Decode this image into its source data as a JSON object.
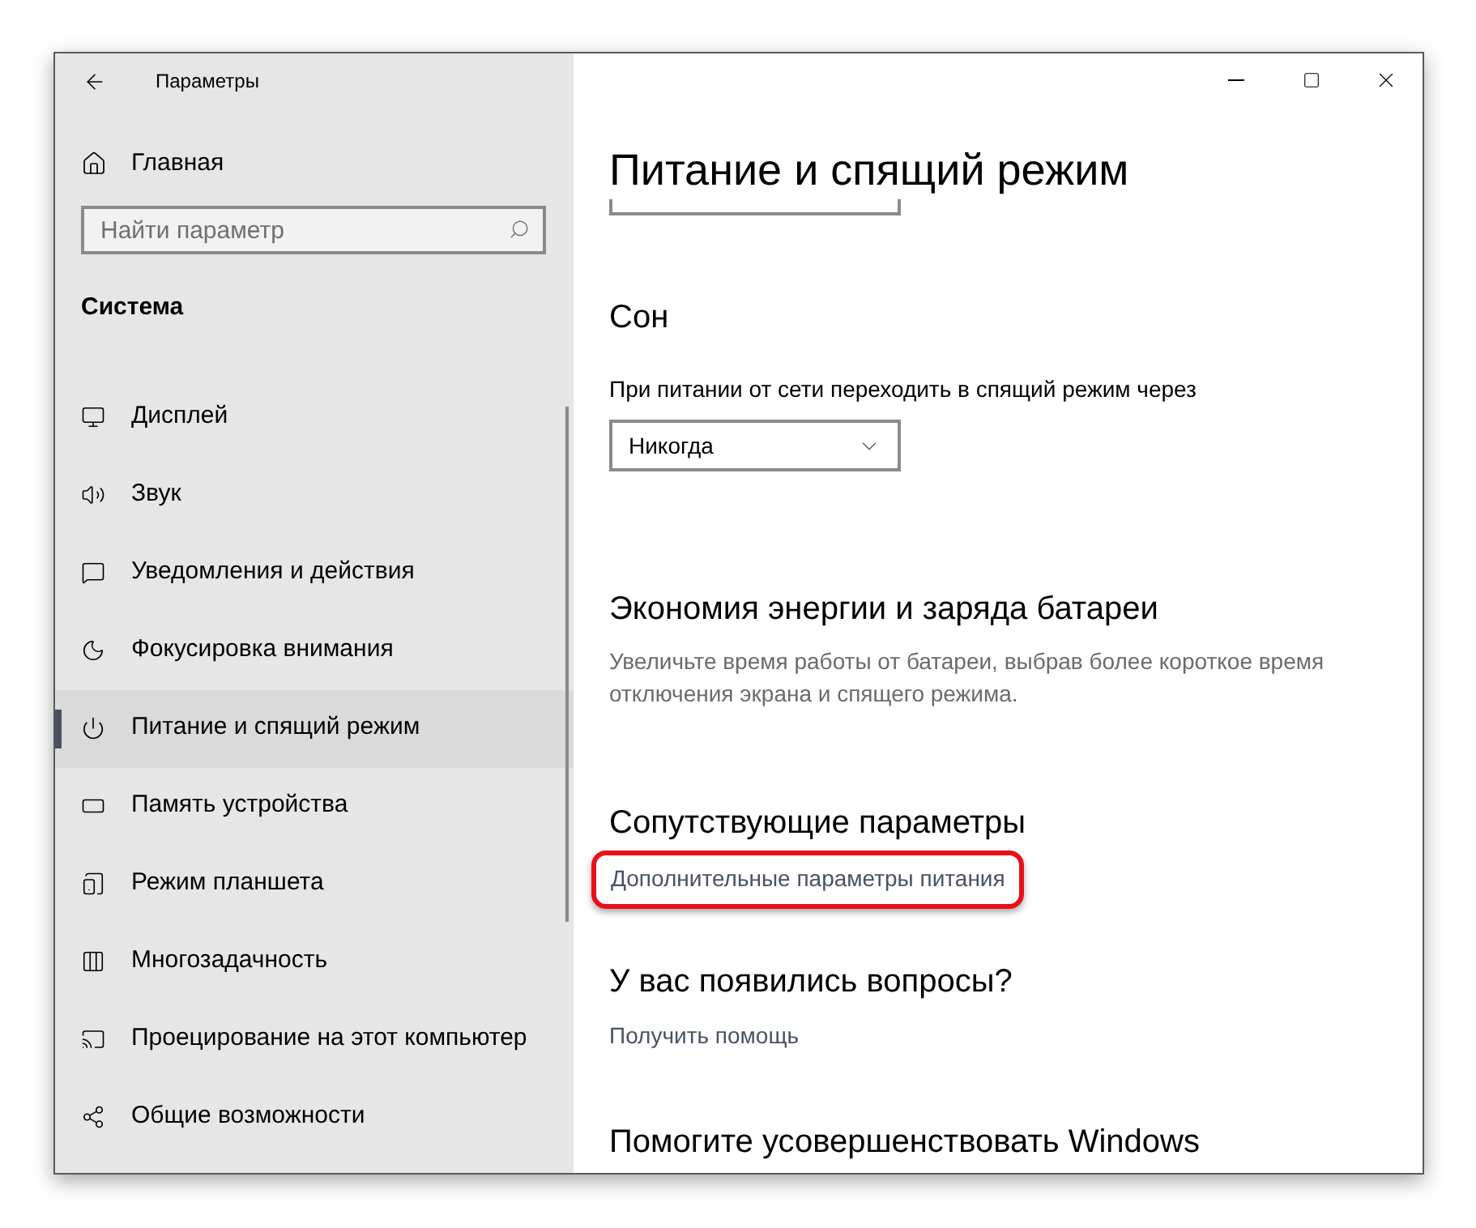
{
  "window": {
    "title": "Параметры"
  },
  "sidebar": {
    "home": "Главная",
    "search": {
      "placeholder": "Найти параметр"
    },
    "section": "Система",
    "items": [
      {
        "label": "Дисплей",
        "kind": "display",
        "selected": false
      },
      {
        "label": "Звук",
        "kind": "sound",
        "selected": false
      },
      {
        "label": "Уведомления и действия",
        "kind": "notifications",
        "selected": false
      },
      {
        "label": "Фокусировка внимания",
        "kind": "focus",
        "selected": false
      },
      {
        "label": "Питание и спящий режим",
        "kind": "power",
        "selected": true
      },
      {
        "label": "Память устройства",
        "kind": "storage",
        "selected": false
      },
      {
        "label": "Режим планшета",
        "kind": "tablet",
        "selected": false
      },
      {
        "label": "Многозадачность",
        "kind": "multitasking",
        "selected": false
      },
      {
        "label": "Проецирование на этот компьютер",
        "kind": "projecting",
        "selected": false
      },
      {
        "label": "Общие возможности",
        "kind": "shared",
        "selected": false
      }
    ]
  },
  "content": {
    "title": "Питание и спящий режим",
    "sleep": {
      "heading": "Сон",
      "label": "При питании от сети переходить в спящий режим через",
      "value": "Никогда"
    },
    "battery": {
      "heading": "Экономия энергии и заряда батареи",
      "text": "Увеличьте время работы от батареи, выбрав более короткое время отключения экрана и спящего режима."
    },
    "related": {
      "heading": "Сопутствующие параметры",
      "link": "Дополнительные параметры питания",
      "highlighted": true
    },
    "questions": {
      "heading": "У вас появились вопросы?",
      "link": "Получить помощь"
    },
    "improve": {
      "heading": "Помогите усовершенствовать Windows"
    }
  }
}
